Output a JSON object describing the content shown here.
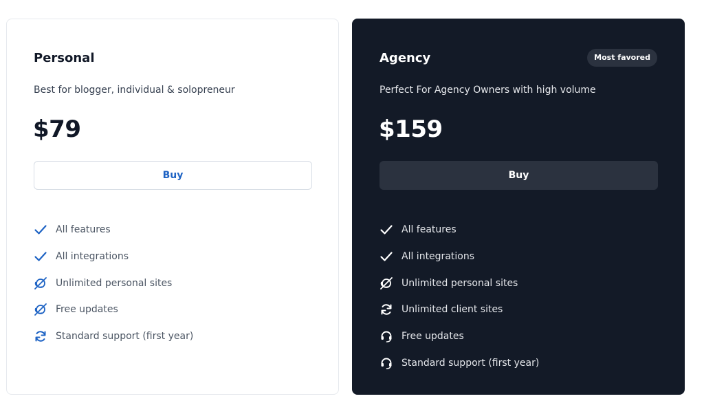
{
  "colors": {
    "accent_blue": "#1e63c4",
    "dark_card": "#131a27",
    "dark_button": "#2b323f"
  },
  "plans": {
    "personal": {
      "name": "Personal",
      "description": "Best for blogger, individual & solopreneur",
      "price": "$79",
      "buy_label": "Buy",
      "features": [
        {
          "icon": "check-icon",
          "label": "All features"
        },
        {
          "icon": "check-icon",
          "label": "All integrations"
        },
        {
          "icon": "globe-orbit-icon",
          "label": "Unlimited personal sites"
        },
        {
          "icon": "globe-orbit-icon",
          "label": "Free updates"
        },
        {
          "icon": "refresh-icon",
          "label": "Standard support (first year)"
        }
      ]
    },
    "agency": {
      "name": "Agency",
      "badge": "Most favored",
      "description": "Perfect For Agency Owners with high volume",
      "price": "$159",
      "buy_label": "Buy",
      "features": [
        {
          "icon": "check-icon",
          "label": "All features"
        },
        {
          "icon": "check-icon",
          "label": "All integrations"
        },
        {
          "icon": "globe-orbit-icon",
          "label": "Unlimited personal sites"
        },
        {
          "icon": "refresh-icon",
          "label": "Unlimited client sites"
        },
        {
          "icon": "headset-icon",
          "label": "Free updates"
        },
        {
          "icon": "headset-icon",
          "label": "Standard support (first year)"
        }
      ]
    }
  }
}
